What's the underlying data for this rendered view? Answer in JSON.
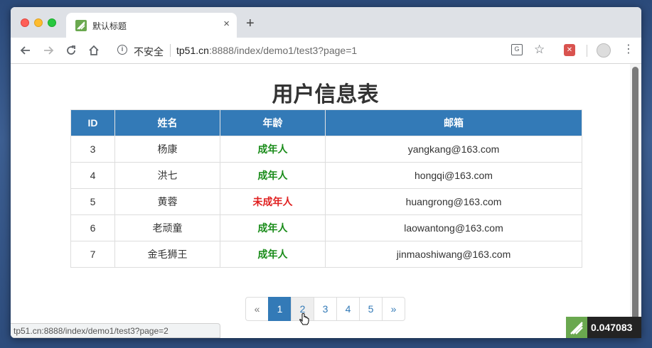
{
  "tab": {
    "title": "默认标题",
    "close": "×",
    "new_tab": "+"
  },
  "toolbar": {
    "security_label": "不安全",
    "url_host": "tp51.cn",
    "url_rest": ":8888/index/demo1/test3?page=1",
    "info_glyph": "i",
    "translate_glyph": "G",
    "extension_glyph": "✕"
  },
  "page": {
    "title": "用户信息表",
    "table": {
      "headers": [
        "ID",
        "姓名",
        "年龄",
        "邮箱"
      ],
      "rows": [
        {
          "id": "3",
          "name": "杨康",
          "age": "成年人",
          "email": "yangkang@163.com"
        },
        {
          "id": "4",
          "name": "洪七",
          "age": "成年人",
          "email": "hongqi@163.com"
        },
        {
          "id": "5",
          "name": "黄蓉",
          "age": "未成年人",
          "email": "huangrong@163.com"
        },
        {
          "id": "6",
          "name": "老顽童",
          "age": "成年人",
          "email": "laowantong@163.com"
        },
        {
          "id": "7",
          "name": "金毛狮王",
          "age": "成年人",
          "email": "jinmaoshiwang@163.com"
        }
      ]
    },
    "pagination": {
      "prev": "«",
      "pages": [
        "1",
        "2",
        "3",
        "4",
        "5"
      ],
      "next": "»",
      "active": "1",
      "hover": "2"
    }
  },
  "status_bar": {
    "url": "tp51.cn:8888/index/demo1/test3?page=2"
  },
  "debug_badge": {
    "time": "0.047083"
  },
  "colors": {
    "header_blue": "#337ab7",
    "adult_green": "#1a8c1a",
    "minor_red": "#e02020"
  },
  "icons": [
    "back-arrow-icon",
    "forward-arrow-icon",
    "reload-icon",
    "home-icon",
    "info-icon",
    "translate-icon",
    "star-icon",
    "extension-icon",
    "avatar",
    "menu-icon"
  ]
}
